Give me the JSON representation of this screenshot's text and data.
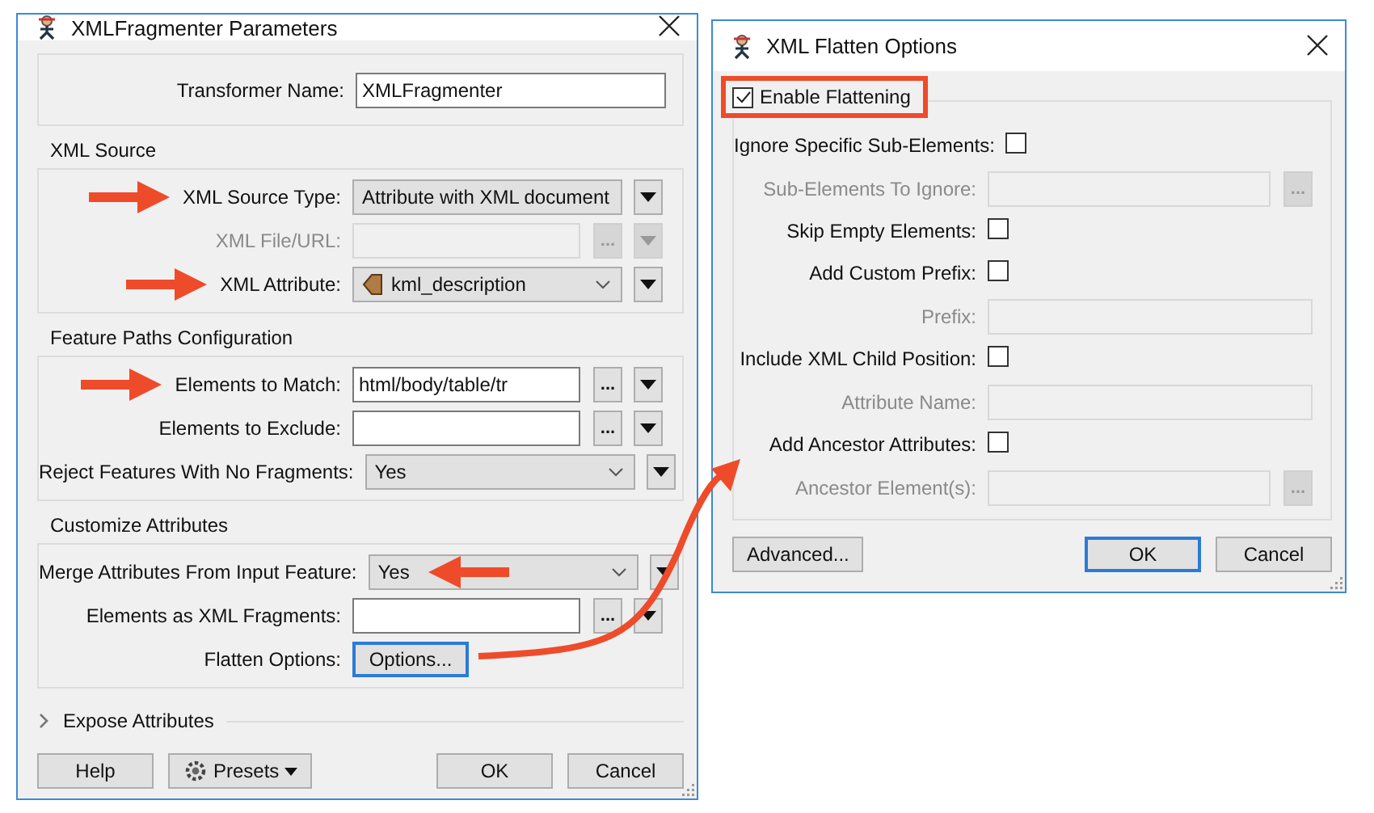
{
  "parameters_dialog": {
    "title": "XMLFragmenter Parameters",
    "transformer_name": {
      "label": "Transformer Name:",
      "value": "XMLFragmenter"
    },
    "groups": [
      {
        "title": "XML Source",
        "rows": [
          {
            "label": "XML Source Type:",
            "kind": "select",
            "value": "Attribute with XML document",
            "disabled": false,
            "menu": true,
            "arrow_at_label": true
          },
          {
            "label": "XML File/URL:",
            "kind": "text",
            "disabled": true,
            "browse": "...",
            "menu": true
          },
          {
            "label": "XML Attribute:",
            "kind": "select",
            "value": "kml_description",
            "attribute": true,
            "disabled": false,
            "menu": true,
            "arrow_at_label": true
          }
        ]
      },
      {
        "title": "Feature Paths Configuration",
        "rows": [
          {
            "label": "Elements to Match:",
            "kind": "text",
            "value": "html/body/table/tr",
            "disabled": false,
            "browse": "...",
            "menu": true,
            "arrow_at_label": true
          },
          {
            "label": "Elements to Exclude:",
            "kind": "text",
            "disabled": false,
            "browse": "...",
            "menu": true
          },
          {
            "label": "Reject Features With No Fragments:",
            "kind": "select",
            "value": "Yes",
            "disabled": false,
            "menu": true
          }
        ]
      },
      {
        "title": "Customize Attributes",
        "rows": [
          {
            "label": "Merge Attributes From Input Feature:",
            "kind": "select",
            "value": "Yes",
            "disabled": false,
            "menu": true,
            "arrow_at_value": true
          },
          {
            "label": "Elements as XML Fragments:",
            "kind": "text",
            "disabled": false,
            "browse": "...",
            "menu": true
          },
          {
            "label": "Flatten Options:",
            "kind": "button",
            "value": "Options...",
            "disabled": false,
            "focused": true
          }
        ]
      }
    ],
    "expose": {
      "label": "Expose Attributes",
      "expanded": false
    },
    "left_buttons": [
      {
        "label": "Help",
        "kind": "plain",
        "default": false
      },
      {
        "label": "Presets",
        "kind": "menu",
        "default": false
      }
    ],
    "right_buttons": [
      {
        "label": "OK",
        "kind": "plain",
        "default": false
      },
      {
        "label": "Cancel",
        "kind": "plain",
        "default": false
      }
    ]
  },
  "flatten_dialog": {
    "title": "XML Flatten Options",
    "enable": {
      "label": "Enable Flattening",
      "checked": true,
      "highlighted": true
    },
    "rows": [
      {
        "label": "Ignore Specific Sub-Elements:",
        "kind": "checkbox",
        "checked": false
      },
      {
        "label": "Sub-Elements To Ignore:",
        "kind": "text",
        "disabled": true,
        "browse": "..."
      },
      {
        "label": "Skip Empty Elements:",
        "kind": "checkbox",
        "checked": false
      },
      {
        "label": "Add Custom Prefix:",
        "kind": "checkbox",
        "checked": false
      },
      {
        "label": "Prefix:",
        "kind": "text",
        "disabled": true
      },
      {
        "label": "Include XML Child Position:",
        "kind": "checkbox",
        "checked": false
      },
      {
        "label": "Attribute Name:",
        "kind": "text",
        "disabled": true
      },
      {
        "label": "Add Ancestor Attributes:",
        "kind": "checkbox",
        "checked": false
      },
      {
        "label": "Ancestor Element(s):",
        "kind": "text",
        "disabled": true,
        "browse": "..."
      }
    ],
    "left_buttons": [
      {
        "label": "Advanced...",
        "default": false
      }
    ],
    "right_buttons": [
      {
        "label": "OK",
        "default": true
      },
      {
        "label": "Cancel",
        "default": false
      }
    ]
  }
}
